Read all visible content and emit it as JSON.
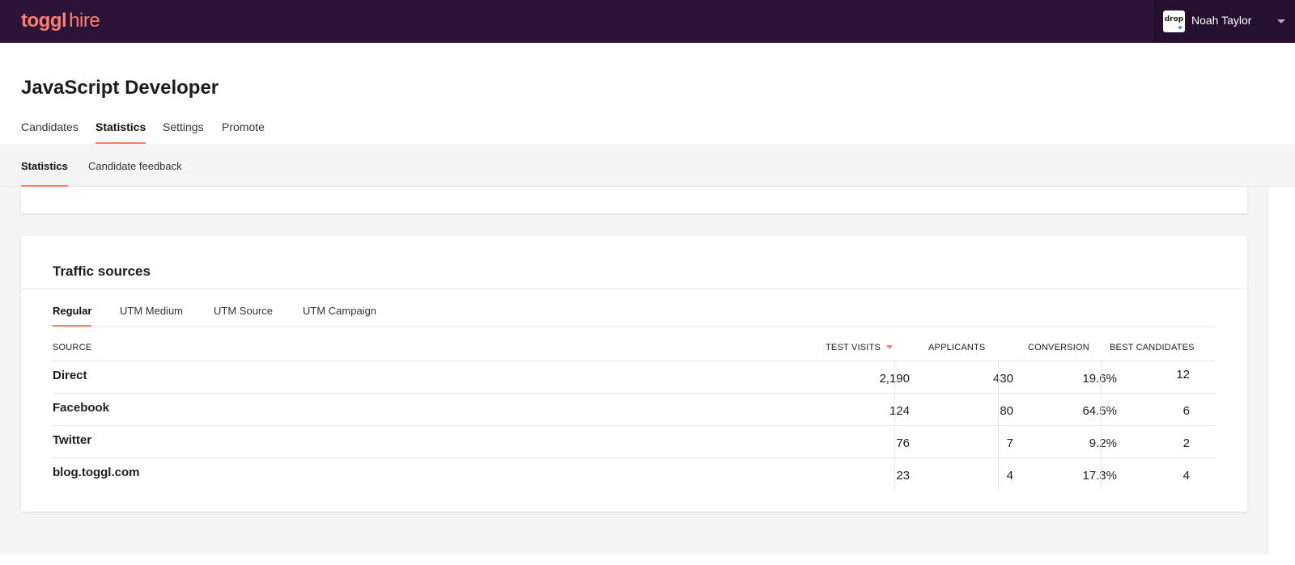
{
  "header": {
    "logo_brand": "toggl",
    "logo_product": "hire",
    "user": {
      "avatar_text": "drop",
      "name": "Noah Taylor"
    }
  },
  "page": {
    "title": "JavaScript Developer"
  },
  "main_tabs": [
    {
      "label": "Candidates",
      "active": false
    },
    {
      "label": "Statistics",
      "active": true
    },
    {
      "label": "Settings",
      "active": false
    },
    {
      "label": "Promote",
      "active": false
    }
  ],
  "sub_tabs": [
    {
      "label": "Statistics",
      "active": true
    },
    {
      "label": "Candidate feedback",
      "active": false
    }
  ],
  "traffic": {
    "title": "Traffic sources",
    "tabs": [
      {
        "label": "Regular",
        "active": true
      },
      {
        "label": "UTM Medium",
        "active": false
      },
      {
        "label": "UTM Source",
        "active": false
      },
      {
        "label": "UTM Campaign",
        "active": false
      }
    ],
    "columns": [
      "SOURCE",
      "TEST VISITS",
      "APPLICANTS",
      "CONVERSION",
      "BEST CANDIDATES"
    ],
    "sorted_column": "TEST VISITS",
    "rows": [
      {
        "source": "Direct",
        "test_visits": "2,190",
        "applicants": "430",
        "conversion": "19.6%",
        "best_candidates": "12"
      },
      {
        "source": "Facebook",
        "test_visits": "124",
        "applicants": "80",
        "conversion": "64.5%",
        "best_candidates": "6"
      },
      {
        "source": "Twitter",
        "test_visits": "76",
        "applicants": "7",
        "conversion": "9.2%",
        "best_candidates": "2"
      },
      {
        "source": "blog.toggl.com",
        "test_visits": "23",
        "applicants": "4",
        "conversion": "17.3%",
        "best_candidates": "4"
      }
    ]
  },
  "colors": {
    "header_bg": "#2c1338",
    "accent": "#fd7f6f",
    "surface": "#f4f4f4"
  }
}
